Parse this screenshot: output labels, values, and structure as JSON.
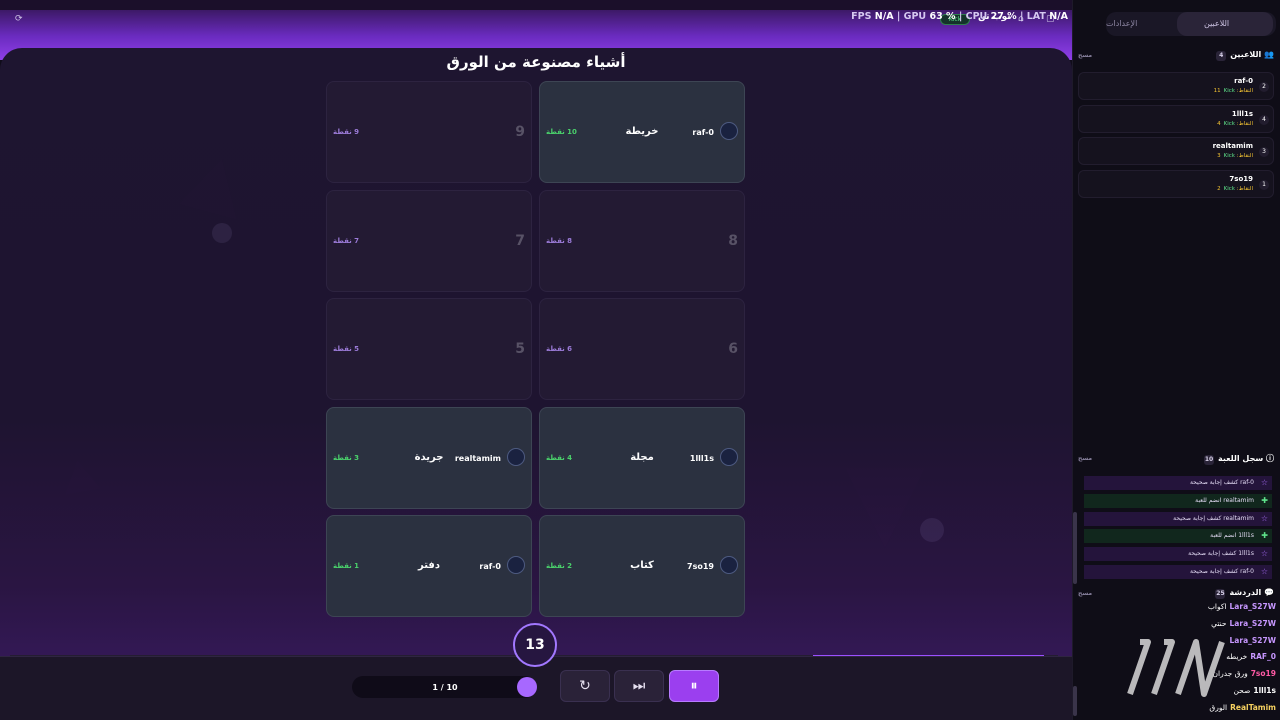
{
  "topbar": {
    "stats": {
      "fps_label": "FPS",
      "fps": "N/A",
      "gpu_label": "GPU",
      "gpu": "63 %",
      "cpu_label": "CPU",
      "cpu": "27 %",
      "lat_label": "LAT",
      "lat": "N/A"
    },
    "channel": "توب تن",
    "kick_badge": "Kick"
  },
  "board": {
    "title": "أشياء مصنوعة من الورق",
    "cards": [
      {
        "num": "",
        "points": "10 نقطة",
        "revealed": true,
        "player": "raf-0",
        "answer": "خريطة"
      },
      {
        "num": "9",
        "points": "9 نقطة",
        "revealed": false,
        "player": "",
        "answer": ""
      },
      {
        "num": "8",
        "points": "8 نقطة",
        "revealed": false,
        "player": "",
        "answer": ""
      },
      {
        "num": "7",
        "points": "7 نقطة",
        "revealed": false,
        "player": "",
        "answer": ""
      },
      {
        "num": "6",
        "points": "6 نقطة",
        "revealed": false,
        "player": "",
        "answer": ""
      },
      {
        "num": "5",
        "points": "5 نقطة",
        "revealed": false,
        "player": "",
        "answer": ""
      },
      {
        "num": "",
        "points": "4 نقطة",
        "revealed": true,
        "player": "1lll1s",
        "answer": "مجلة"
      },
      {
        "num": "",
        "points": "3 نقطة",
        "revealed": true,
        "player": "realtamim",
        "answer": "جريدة"
      },
      {
        "num": "",
        "points": "2 نقطة",
        "revealed": true,
        "player": "7so19",
        "answer": "كتاب"
      },
      {
        "num": "",
        "points": "1 نقطة",
        "revealed": true,
        "player": "raf-0",
        "answer": "دفتر"
      }
    ],
    "timer": "13",
    "progress": 0.22
  },
  "controls": {
    "round": "1 / 10",
    "reset_icon": "↻",
    "skip_icon": "⏭",
    "pause_icon": "⏸"
  },
  "sidebar": {
    "tabs": {
      "players": "اللاعبين",
      "settings": "الإعدادات"
    },
    "players_section": {
      "title": "اللاعبين",
      "count": "4",
      "clear": "مسح"
    },
    "players": [
      {
        "rank": "2",
        "name": "raf-0",
        "score": "النقاط: 11",
        "platform": "Kick"
      },
      {
        "rank": "4",
        "name": "1lll1s",
        "score": "النقاط: 4",
        "platform": "Kick"
      },
      {
        "rank": "3",
        "name": "realtamim",
        "score": "النقاط: 3",
        "platform": "Kick"
      },
      {
        "rank": "1",
        "name": "7so19",
        "score": "النقاط: 2",
        "platform": "Kick"
      }
    ],
    "log_section": {
      "title": "سجل اللعبة",
      "count": "10",
      "clear": "مسح"
    },
    "log": [
      {
        "text": "raf-0 كشف إجابة صحيحة",
        "kind": "v"
      },
      {
        "text": "realtamim انضم للعبة",
        "kind": "g"
      },
      {
        "text": "realtamim كشف إجابة صحيحة",
        "kind": "v"
      },
      {
        "text": "1lll1s انضم للعبة",
        "kind": "g"
      },
      {
        "text": "1lll1s كشف إجابة صحيحة",
        "kind": "v"
      },
      {
        "text": "raf-0 كشف إجابة صحيحة",
        "kind": "v"
      }
    ],
    "chat_section": {
      "title": "الدردشة",
      "count": "25",
      "clear": "مسح"
    },
    "chat": [
      {
        "name": "Lara_S27W",
        "msg": "اكواب",
        "color": ""
      },
      {
        "name": "Lara_S27W",
        "msg": "حنتي",
        "color": ""
      },
      {
        "name": "Lara_S27W",
        "msg": "",
        "color": ""
      },
      {
        "name": "RAF_0",
        "msg": "خريطه",
        "color": ""
      },
      {
        "name": "7so19",
        "msg": "ورق جدران",
        "color": "pink"
      },
      {
        "name": "1lll1s",
        "msg": "صحن",
        "color": "w"
      },
      {
        "name": "RealTamim",
        "msg": "الورق",
        "color": "y"
      }
    ]
  },
  "colors": {
    "accent": "#9b3fef",
    "revealed_points": "#4ad16b",
    "hidden_points": "#9b7bd8",
    "score": "#f2c232"
  }
}
